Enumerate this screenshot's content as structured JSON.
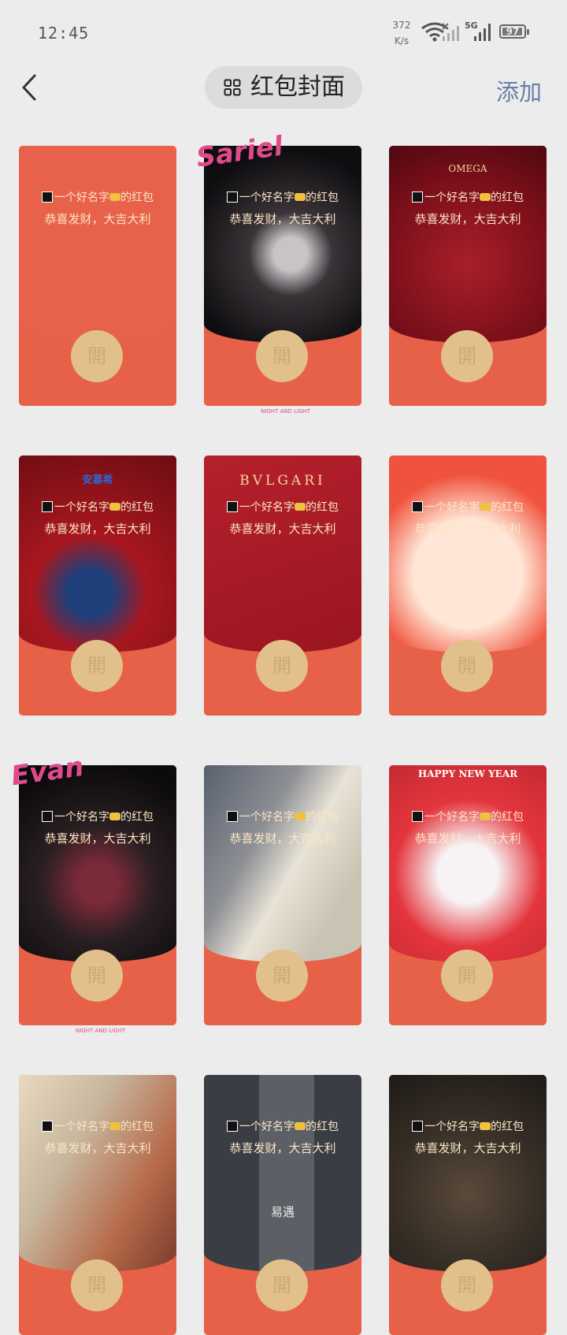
{
  "status": {
    "time": "12:45",
    "net_speed_value": "372",
    "net_speed_unit": "K/s",
    "network": "5G",
    "battery": "97",
    "battery_level": 0.97,
    "icons": [
      "wifi-icon",
      "signal-icon",
      "battery-icon"
    ]
  },
  "header": {
    "title": "红包封面",
    "add_label": "添加",
    "icons": [
      "back-chevron-icon",
      "grid-icon"
    ]
  },
  "cards": [
    {
      "line1_name": "一个好名字",
      "line1_suffix": "的红包",
      "line2": "恭喜发财，大吉大利",
      "open": "開",
      "theme": "plain-red"
    },
    {
      "line1_name": "一个好名字",
      "line1_suffix": "的红包",
      "line2": "恭喜发财，大吉大利",
      "open": "開",
      "theme": "anime-sariel",
      "sticker": "Sariel",
      "footer": "NIGHT AND LIGHT"
    },
    {
      "line1_name": "一个好名字",
      "line1_suffix": "的红包",
      "line2": "恭喜发财，大吉大利",
      "open": "開",
      "theme": "omega-dragon",
      "brand": "OMEGA"
    },
    {
      "line1_name": "一个好名字",
      "line1_suffix": "的红包",
      "line2": "恭喜发财，大吉大利",
      "open": "開",
      "theme": "dragon-celebrity",
      "brand": "安慕希"
    },
    {
      "line1_name": "一个好名字",
      "line1_suffix": "的红包",
      "line2": "恭喜发财，大吉大利",
      "open": "開",
      "theme": "bvlgari-dragon",
      "brand": "BVLGARI"
    },
    {
      "line1_name": "一个好名字",
      "line1_suffix": "的红包",
      "line2": "恭喜发财，大吉大利",
      "open": "開",
      "theme": "chibi-group"
    },
    {
      "line1_name": "一个好名字",
      "line1_suffix": "的红包",
      "line2": "恭喜发财，大吉大利",
      "open": "開",
      "theme": "anime-evan",
      "sticker": "Evan",
      "footer": "NIGHT AND LIGHT"
    },
    {
      "line1_name": "一个好名字",
      "line1_suffix": "的红包",
      "line2": "恭喜发财，大吉大利",
      "open": "開",
      "theme": "anime-pale"
    },
    {
      "line1_name": "一个好名字",
      "line1_suffix": "的红包",
      "line2": "恭喜发财，大吉大利",
      "open": "開",
      "theme": "happy-new-year",
      "brand": "HAPPY NEW YEAR"
    },
    {
      "line1_name": "一个好名字",
      "line1_suffix": "的红包",
      "line2": "恭喜发财，大吉大利",
      "open": "開",
      "theme": "silver-hair"
    },
    {
      "line1_name": "一个好名字",
      "line1_suffix": "的红包",
      "line2": "恭喜发财，大吉大利",
      "open": "開",
      "theme": "collage",
      "caption": "易遇"
    },
    {
      "line1_name": "一个好名字",
      "line1_suffix": "的红包",
      "line2": "恭喜发财，大吉大利",
      "open": "開",
      "theme": "dark-hair"
    }
  ],
  "colors": {
    "background": "#ececec",
    "envelope_red": "#e76048",
    "open_gold": "#e2c08c",
    "text_gold": "#fbe6c4",
    "add_blue": "#6b7ea8"
  }
}
